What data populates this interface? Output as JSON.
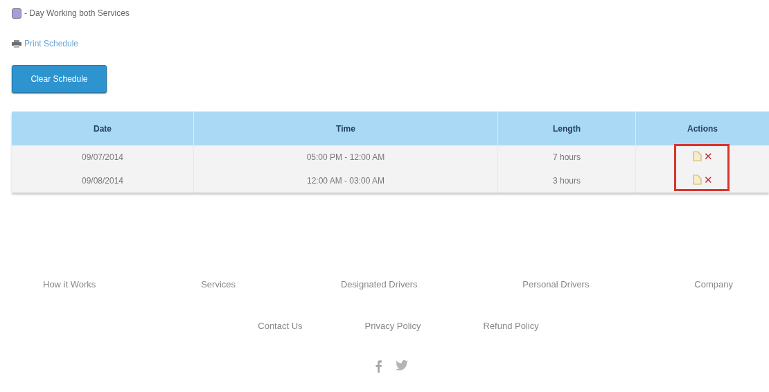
{
  "legend": {
    "color": "#a99be0",
    "label": "- Day Working both Services"
  },
  "print_link": "Print Schedule",
  "clear_button": "Clear Schedule",
  "table": {
    "columns": [
      "Date",
      "Time",
      "Length",
      "Actions"
    ],
    "rows": [
      {
        "date": "09/07/2014",
        "time": "05:00 PM - 12:00 AM",
        "length": "7 hours",
        "delete": "✕"
      },
      {
        "date": "09/08/2014",
        "time": "12:00 AM - 03:00 AM",
        "length": "3 hours",
        "delete": "✕"
      }
    ],
    "actions_highlighted": true
  },
  "footer": {
    "links": [
      "How it Works",
      "Services",
      "Designated Drivers",
      "Personal Drivers",
      "Company"
    ],
    "links_2": [
      "Contact Us",
      "Privacy Policy",
      "Refund Policy"
    ],
    "social": [
      {
        "kind": "facebook"
      },
      {
        "kind": "twitter"
      }
    ]
  }
}
